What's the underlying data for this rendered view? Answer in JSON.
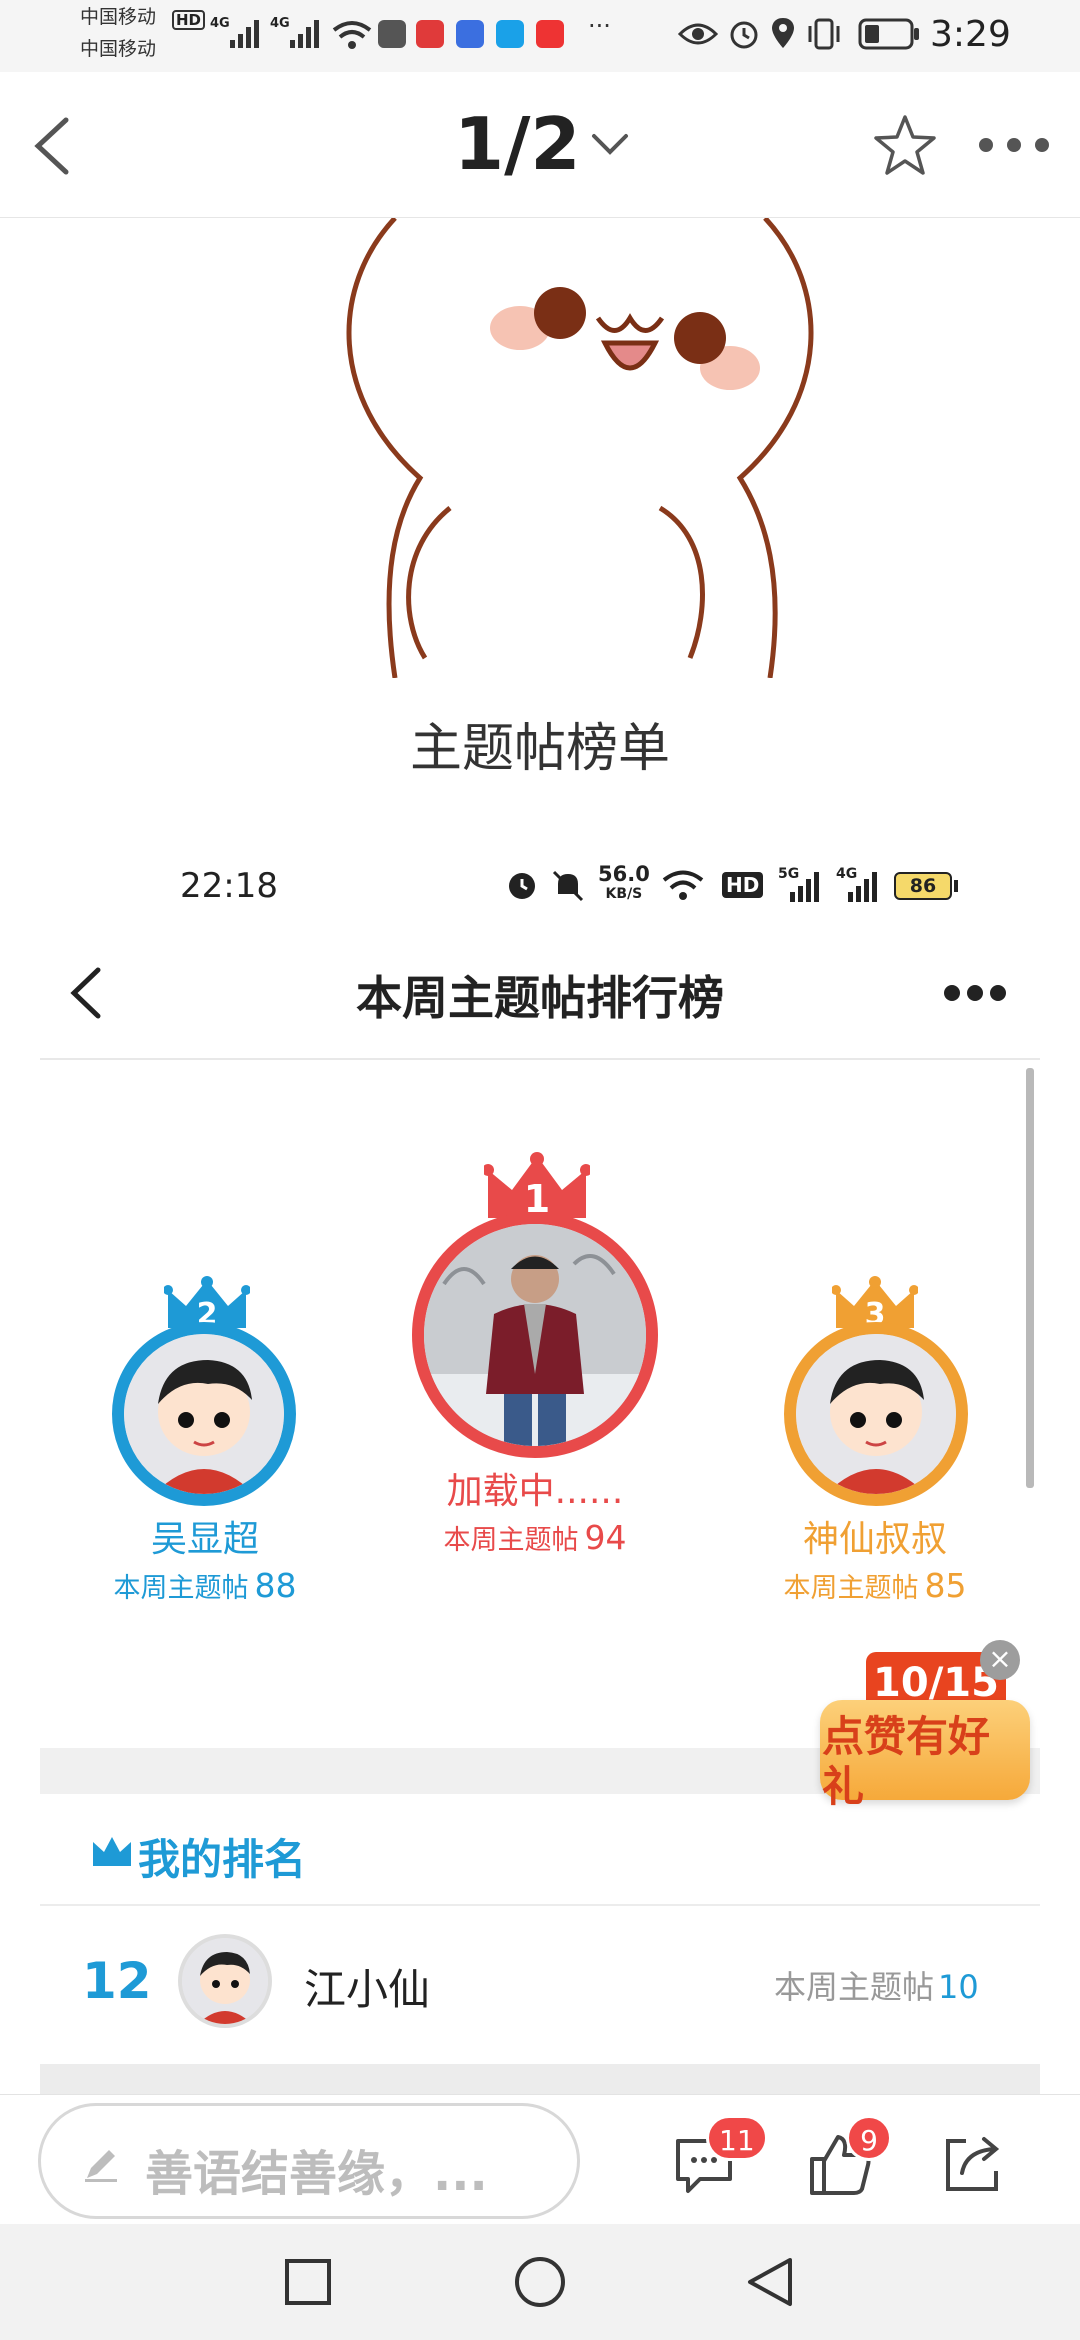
{
  "phone_status": {
    "carrier1": "中国移动",
    "carrier2": "中国移动",
    "hd": "HD",
    "net1": "4G",
    "net2": "4G",
    "time": "3:29",
    "more": "···"
  },
  "viewer": {
    "page_indicator": "1/2",
    "post_title": "主题帖榜单"
  },
  "inner": {
    "time": "22:18",
    "speed_value": "56.0",
    "speed_unit": "KB/S",
    "hd": "HD",
    "net1": "5G",
    "net2": "4G",
    "battery": "86",
    "title": "本周主题帖排行榜",
    "podium": [
      {
        "rank": "2",
        "name": "吴显超",
        "label": "本周主题帖",
        "count": "88",
        "color": "#1e9ad6"
      },
      {
        "rank": "1",
        "name": "加载中......",
        "label": "本周主题帖",
        "count": "94",
        "color": "#e84a4a"
      },
      {
        "rank": "3",
        "name": "神仙叔叔",
        "label": "本周主题帖",
        "count": "85",
        "color": "#f0a033"
      }
    ],
    "promo_date": "10/15",
    "promo_text": "点赞有好礼",
    "my_rank_title": "我的排名",
    "my_rank": {
      "rank": "12",
      "name": "江小仙",
      "label": "本周主题帖",
      "count": "10"
    }
  },
  "bottom": {
    "comment_placeholder": "善语结善缘，...",
    "comment_count": "11",
    "like_count": "9"
  },
  "colors": {
    "accent_blue": "#1e9ad6",
    "gold": "#f0a033",
    "red": "#e84a4a"
  }
}
